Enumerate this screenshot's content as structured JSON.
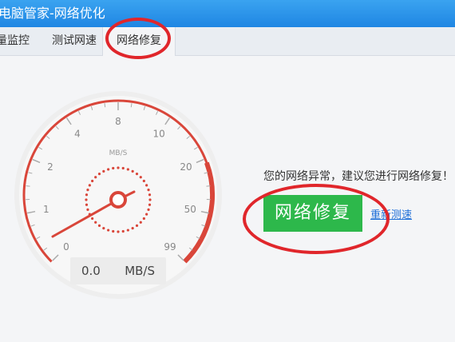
{
  "window": {
    "title": "电脑管家-网络优化"
  },
  "tabs": [
    {
      "label": "量监控"
    },
    {
      "label": "测试网速"
    },
    {
      "label": "网络修复"
    }
  ],
  "gauge": {
    "unit": "MB/S",
    "ticks": [
      "0",
      "1",
      "2",
      "4",
      "8",
      "10",
      "20",
      "50",
      "99"
    ],
    "value": 0.0
  },
  "readout": {
    "value": "0.0",
    "unit": "MB/S"
  },
  "message": "您的网络异常，建议您进行网络修复！",
  "fix_button": "网络修复",
  "retest_link": "重新测速",
  "colors": {
    "accent": "#1f86e3",
    "gauge_red": "#d9463a",
    "button_green": "#2db84b",
    "annotation_red": "#e0262b"
  }
}
